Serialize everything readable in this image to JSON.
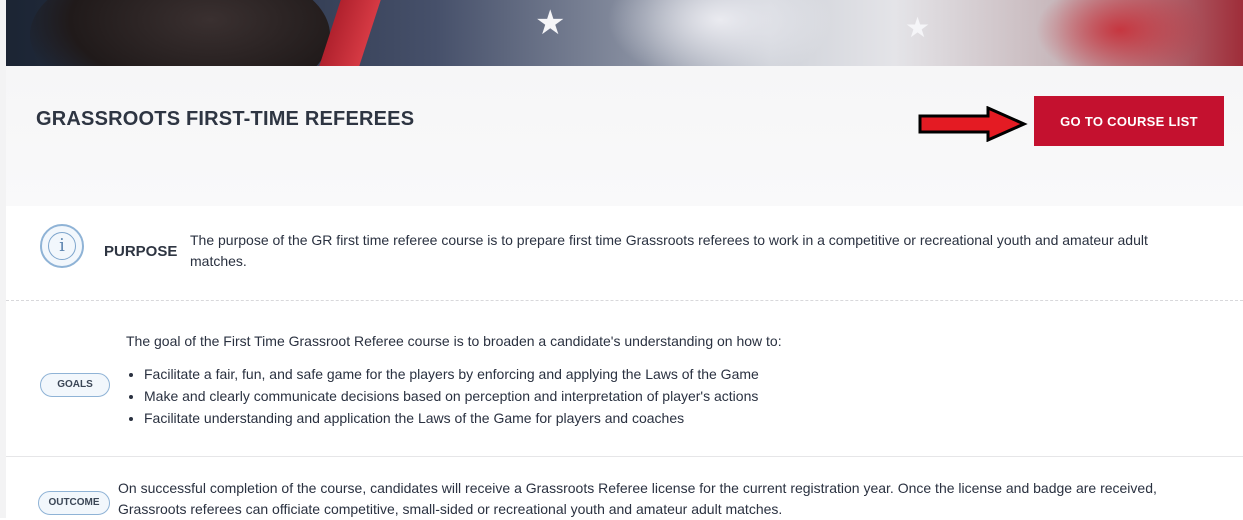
{
  "page": {
    "course_title": "GRASSROOTS FIRST-TIME REFEREES",
    "course_list_button": "GO TO COURSE LIST",
    "accent_color": "#c4112f",
    "annotation": "red-arrow-pointing-right"
  },
  "purpose": {
    "icon": "info-icon",
    "label": "PURPOSE",
    "text": "The purpose of the GR first time referee course is to prepare first time Grassroots referees to work in a competitive or recreational youth and amateur adult matches."
  },
  "goals": {
    "label": "GOALS",
    "intro": "The goal of the First Time Grassroot Referee course is to broaden a candidate's understanding on how to:",
    "items": [
      "Facilitate a fair, fun, and safe game for the players by enforcing and applying the Laws of the Game",
      "Make and clearly communicate decisions based on perception and interpretation of player's actions",
      "Facilitate understanding and application the Laws of the Game for players and coaches"
    ]
  },
  "outcome": {
    "label": "OUTCOME",
    "text": "On successful completion of the course, candidates will receive a Grassroots Referee license for the current registration year. Once the license and badge are received, Grassroots referees can officiate competitive, small-sided or recreational youth and amateur adult matches."
  }
}
